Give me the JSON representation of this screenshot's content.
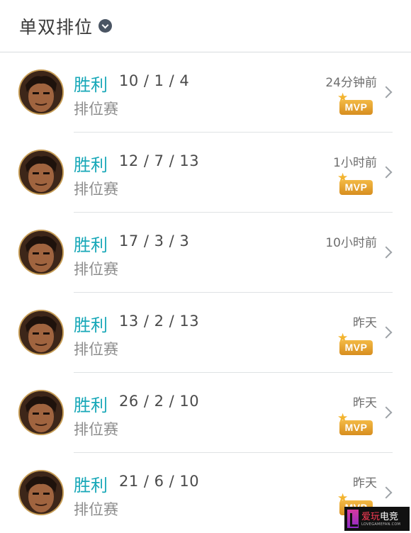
{
  "header": {
    "title": "单双排位",
    "dropdown_icon": "chevron-down-icon"
  },
  "matches": [
    {
      "result": "胜利",
      "kda": "10 / 1 / 4",
      "mode": "排位赛",
      "time": "24分钟前",
      "mvp": true
    },
    {
      "result": "胜利",
      "kda": "12 / 7 / 13",
      "mode": "排位赛",
      "time": "1小时前",
      "mvp": true
    },
    {
      "result": "胜利",
      "kda": "17 / 3 / 3",
      "mode": "排位赛",
      "time": "10小时前",
      "mvp": false
    },
    {
      "result": "胜利",
      "kda": "13 / 2 / 13",
      "mode": "排位赛",
      "time": "昨天",
      "mvp": true
    },
    {
      "result": "胜利",
      "kda": "26 / 2 / 10",
      "mode": "排位赛",
      "time": "昨天",
      "mvp": true
    },
    {
      "result": "胜利",
      "kda": "21 / 6 / 10",
      "mode": "排位赛",
      "time": "昨天",
      "mvp": true
    }
  ],
  "mvp_badge_label": "MVP",
  "watermark": {
    "brand_a": "爱玩",
    "brand_b": "电竞",
    "sub": "LOVEGAMEFAN.COM"
  },
  "colors": {
    "victory": "#18a8b8",
    "mvp_gold": "#e3a030",
    "text_gray": "#8c8c8c"
  }
}
